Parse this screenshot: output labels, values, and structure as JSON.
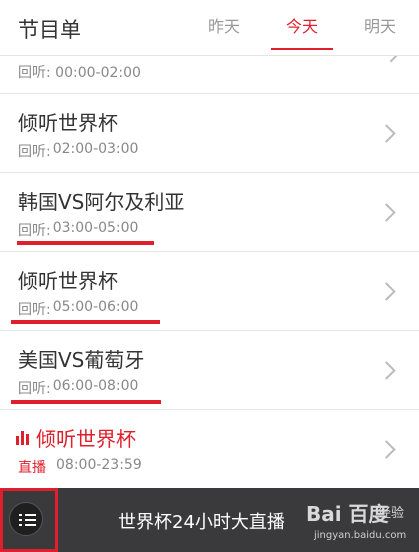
{
  "header": {
    "title": "节目单",
    "tabs": [
      {
        "label": "昨天",
        "active": false
      },
      {
        "label": "今天",
        "active": true
      },
      {
        "label": "明天",
        "active": false
      }
    ]
  },
  "list": {
    "partial_row": {
      "prefix": "回听:",
      "time": "00:00-02:00"
    },
    "rows": [
      {
        "title": "倾听世界杯",
        "prefix": "回听:",
        "time": "02:00-03:00"
      },
      {
        "title": "韩国VS阿尔及利亚",
        "prefix": "回听:",
        "time": "03:00-05:00"
      },
      {
        "title": "倾听世界杯",
        "prefix": "回听:",
        "time": "05:00-06:00"
      },
      {
        "title": "美国VS葡萄牙",
        "prefix": "回听:",
        "time": "06:00-08:00"
      },
      {
        "title": "倾听世界杯",
        "prefix": "直播",
        "time": "08:00-23:59",
        "live": true
      }
    ]
  },
  "footer": {
    "now_playing": "世界杯24小时大直播",
    "watermark_logo": "Bai 百度",
    "watermark_word": "经验",
    "watermark_url": "jingyan.baidu.com"
  },
  "colors": {
    "accent": "#e01f2c",
    "footer_bg": "#3a3a3c",
    "muted_text": "#888888"
  },
  "icons": {
    "chevron": "chevron-right-icon",
    "live": "audio-bars-icon",
    "menu": "list-menu-icon"
  }
}
